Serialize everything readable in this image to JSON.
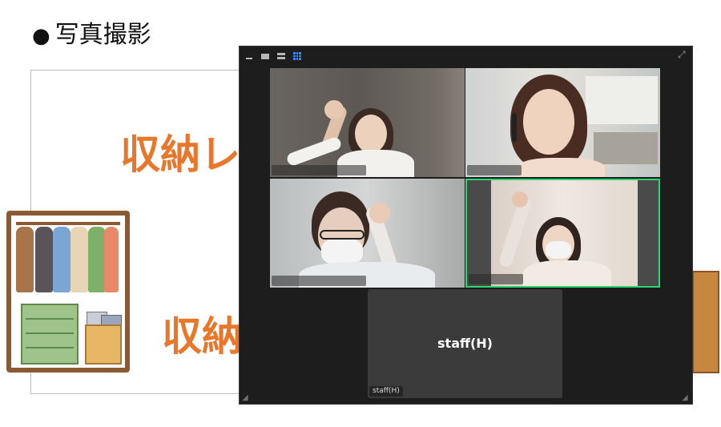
{
  "slide": {
    "title_bullet": "●",
    "title": "写真撮影",
    "text_line1": "収納レ",
    "text_line2": "収納"
  },
  "meeting": {
    "toolbar": {
      "minimize": "minimize",
      "speaker_view": "speaker view",
      "film_view": "film strip view",
      "gallery_view": "gallery view",
      "active_view": "gallery",
      "accent_color": "#2d8cff"
    },
    "participants": [
      {
        "name": "",
        "video": true,
        "active_speaker": false
      },
      {
        "name": "",
        "video": true,
        "active_speaker": false
      },
      {
        "name": "",
        "video": true,
        "active_speaker": false
      },
      {
        "name": "",
        "video": true,
        "active_speaker": true,
        "highlight_color": "#2ed573"
      },
      {
        "name": "staff(H)",
        "label": "staff(H)",
        "video": false,
        "active_speaker": false
      }
    ]
  }
}
